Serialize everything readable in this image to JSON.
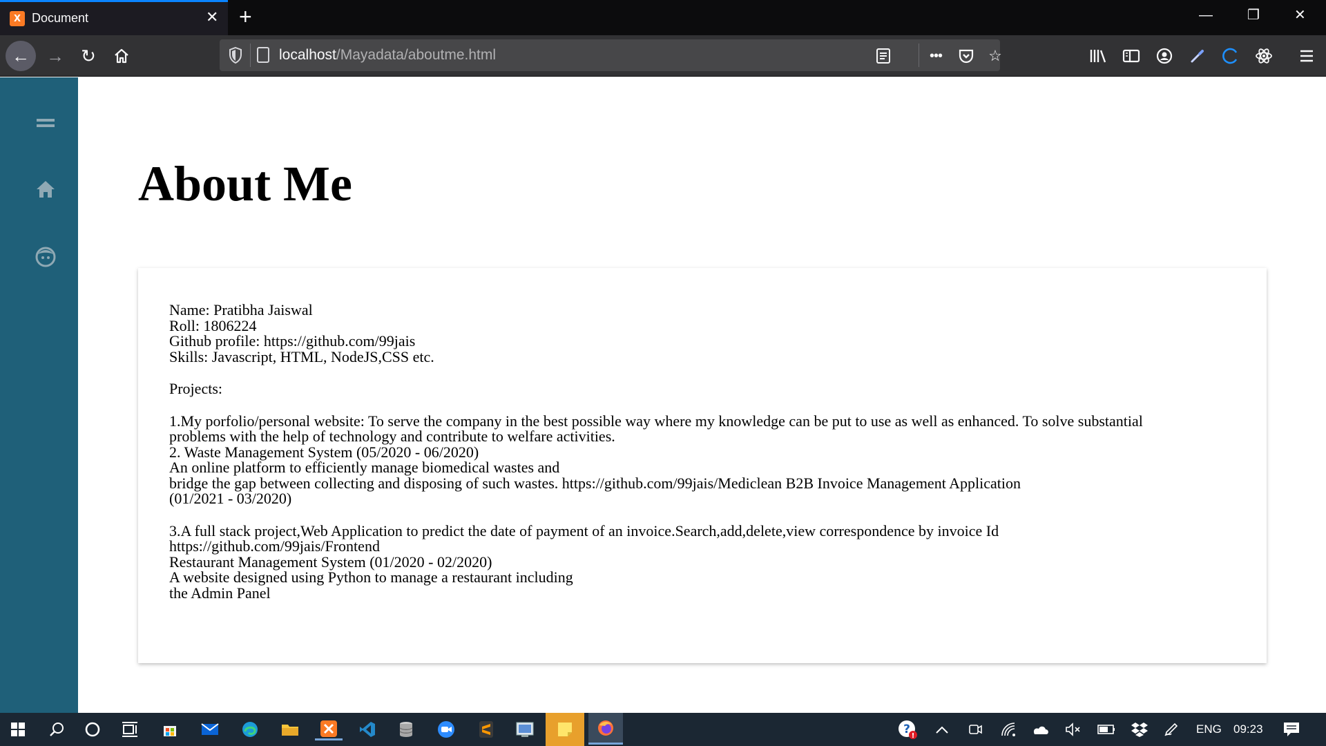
{
  "browser": {
    "tab_title": "Document",
    "tab_favicon_text": "X",
    "tab_close": "✕",
    "new_tab": "+",
    "window_controls": {
      "minimize": "—",
      "restore": "❐",
      "close": "✕"
    },
    "url_host": "localhost",
    "url_path": "/Mayadata/aboutme.html",
    "overflow_menu": "•••"
  },
  "sidebar": {
    "icons": [
      "menu-icon",
      "home-icon",
      "face-icon"
    ]
  },
  "page": {
    "title": "About Me",
    "details": {
      "name": "Name: Pratibha Jaiswal",
      "roll": "Roll: 1806224",
      "github": "Github profile: https://github.com/99jais",
      "skills": "Skills: Javascript, HTML, NodeJS,CSS etc."
    },
    "projects_heading": "Projects:",
    "project1_line1": "1.My porfolio/personal website: To serve the company in the best possible way where my knowledge can be put to use as well as enhanced. To solve substantial",
    "project1_line2": "problems with the help of technology and contribute to welfare activities.",
    "project2_title": "2. Waste Management System (05/2020 - 06/2020)",
    "project2_line1": "An online platform to efficiently manage biomedical wastes and",
    "project2_line2": "bridge the gap between collecting and disposing of such wastes. https://github.com/99jais/Mediclean B2B Invoice Management Application",
    "project2_line3": "(01/2021 - 03/2020)",
    "project3_line1": "3.A full stack project,Web Application to predict the date of payment of an invoice.Search,add,delete,view correspondence by invoice Id",
    "project3_line2": "https://github.com/99jais/Frontend",
    "project4_title": "Restaurant Management System (01/2020 - 02/2020)",
    "project4_line1": "A website designed using Python to manage a restaurant including",
    "project4_line2": "the Admin Panel"
  },
  "taskbar": {
    "language": "ENG",
    "time": "09:23"
  },
  "colors": {
    "sidebar": "#1f6079",
    "sidebar_icon": "#8fa9b4",
    "browser_toolbar": "#323234",
    "tab_accent": "#0a84ff",
    "taskbar": "#1b2733"
  }
}
